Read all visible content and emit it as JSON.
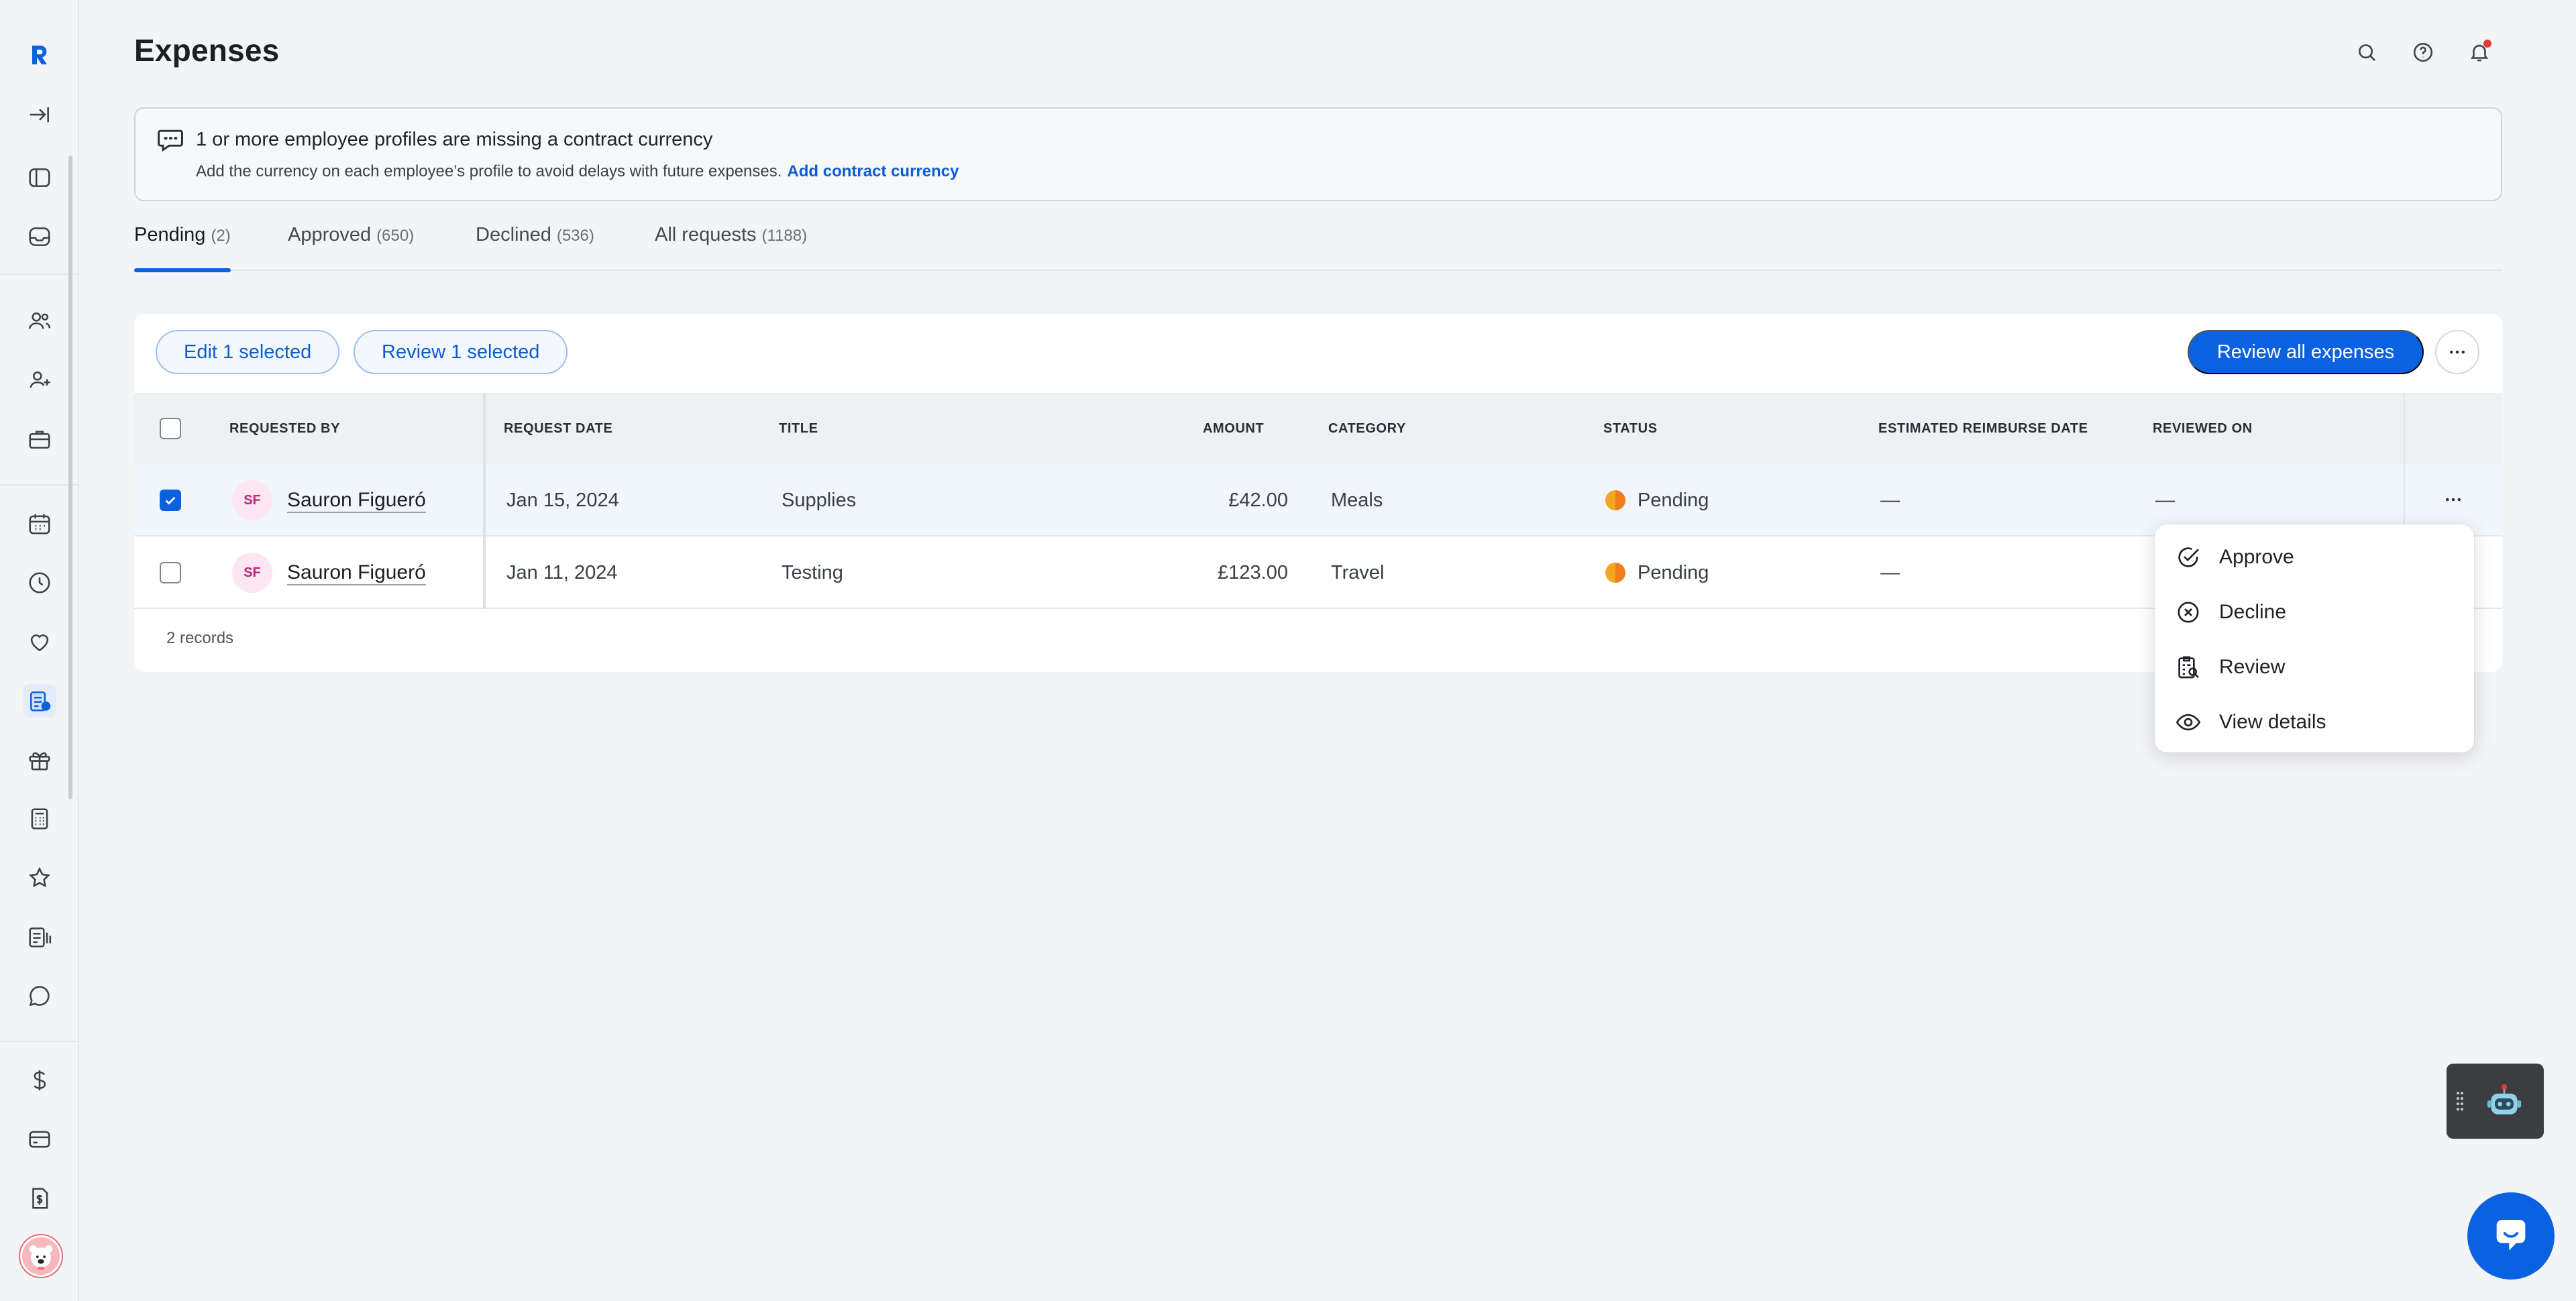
{
  "page": {
    "title": "Expenses"
  },
  "banner": {
    "title": "1 or more employee profiles are missing a contract currency",
    "description": "Add the currency on each employee’s profile to avoid delays with future expenses.",
    "link": "Add contract currency"
  },
  "tabs": [
    {
      "label": "Pending",
      "count": "(2)"
    },
    {
      "label": "Approved",
      "count": "(650)"
    },
    {
      "label": "Declined",
      "count": "(536)"
    },
    {
      "label": "All requests",
      "count": "(1188)"
    }
  ],
  "toolbar": {
    "edit_selected": "Edit 1 selected",
    "review_selected": "Review 1 selected",
    "review_all": "Review all expenses"
  },
  "table": {
    "columns": [
      "REQUESTED BY",
      "REQUEST DATE",
      "TITLE",
      "AMOUNT",
      "CATEGORY",
      "STATUS",
      "ESTIMATED REIMBURSE DATE",
      "REVIEWED ON"
    ],
    "rows": [
      {
        "initials": "SF",
        "name": "Sauron Figueró",
        "date": "Jan 15, 2024",
        "title": "Supplies",
        "amount": "£42.00",
        "category": "Meals",
        "status": "Pending",
        "reimburse": "—",
        "reviewed": "—",
        "selected": true
      },
      {
        "initials": "SF",
        "name": "Sauron Figueró",
        "date": "Jan 11, 2024",
        "title": "Testing",
        "amount": "£123.00",
        "category": "Travel",
        "status": "Pending",
        "reimburse": "—",
        "reviewed": "",
        "selected": false
      }
    ],
    "records": "2 records"
  },
  "row_menu": {
    "items": [
      {
        "label": "Approve",
        "icon": "check-circle-icon"
      },
      {
        "label": "Decline",
        "icon": "x-circle-icon"
      },
      {
        "label": "Review",
        "icon": "review-clipboard-icon"
      },
      {
        "label": "View details",
        "icon": "eye-icon"
      }
    ]
  },
  "colors": {
    "accent": "#0b62e0",
    "link": "#0b5bd3",
    "pending": "#f5a623",
    "background": "#f3f4f6"
  }
}
